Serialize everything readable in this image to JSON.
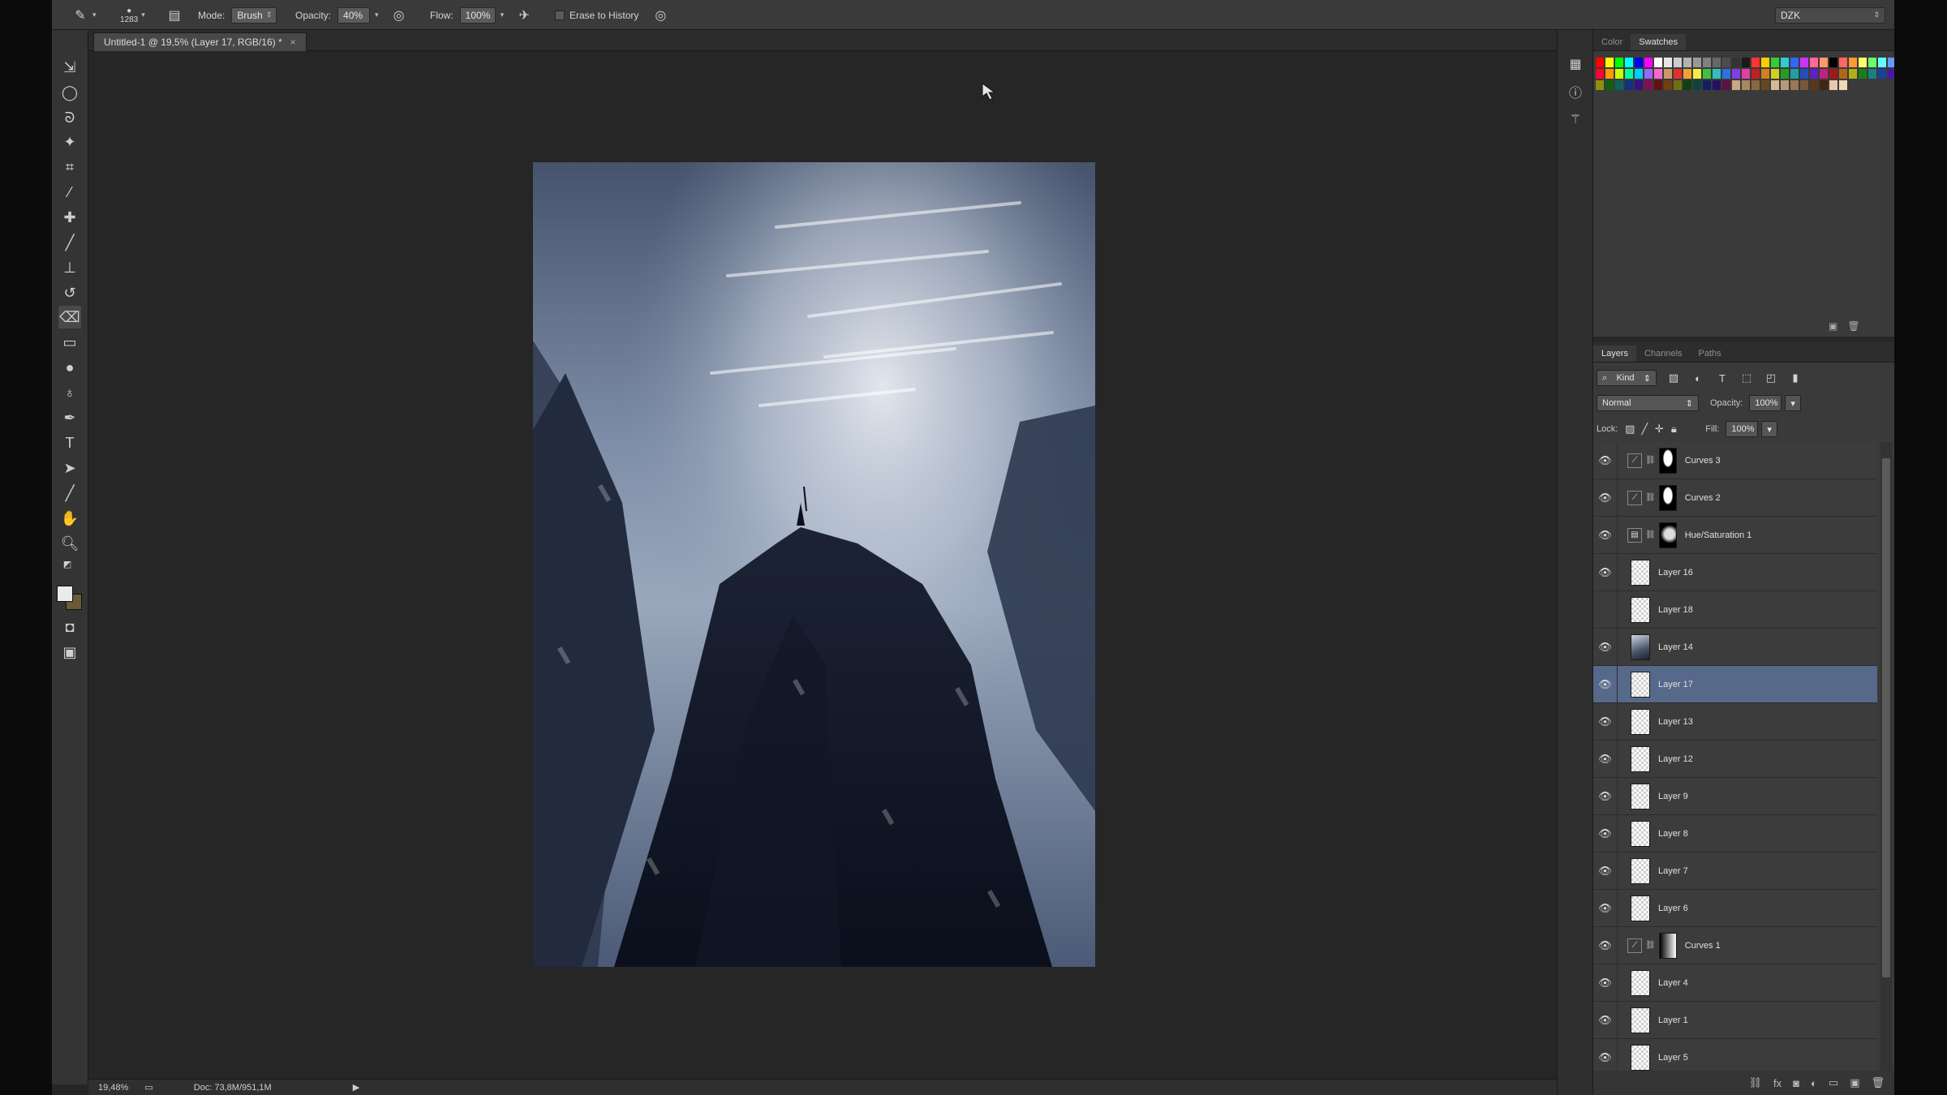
{
  "options_bar": {
    "brush_size": "1283",
    "mode_label": "Mode:",
    "mode_value": "Brush",
    "opacity_label": "Opacity:",
    "opacity_value": "40%",
    "flow_label": "Flow:",
    "flow_value": "100%",
    "erase_to_history": "Erase to History",
    "workspace": "DZK"
  },
  "document": {
    "tab_title": "Untitled-1 @ 19,5% (Layer 17, RGB/16) *",
    "close": "×"
  },
  "status_bar": {
    "zoom": "19,48%",
    "doc_info": "Doc: 73,8M/951,1M"
  },
  "swatches_panel": {
    "tabs": [
      "Color",
      "Swatches"
    ],
    "active_tab": "Swatches",
    "colors": [
      "#ff0000",
      "#ffff00",
      "#00ff00",
      "#00ffff",
      "#0000ff",
      "#ff00ff",
      "#ffffff",
      "#e6e6e6",
      "#cccccc",
      "#b3b3b3",
      "#999999",
      "#808080",
      "#666666",
      "#4d4d4d",
      "#333333",
      "#1a1a1a",
      "#ff3333",
      "#ffcc00",
      "#33cc33",
      "#33cccc",
      "#3366ff",
      "#cc33ff",
      "#ff6699",
      "#ff9966",
      "#000000",
      "#ff6666",
      "#ff9933",
      "#ffff66",
      "#66ff66",
      "#66ffff",
      "#6699ff",
      "#cc66ff",
      "#ff99cc",
      "#ffcc99",
      "#ff0033",
      "#ff9900",
      "#ccff00",
      "#00ff99",
      "#00ccff",
      "#9966ff",
      "#ff66cc",
      "#cc9966",
      "#e03030",
      "#f0a030",
      "#f0f040",
      "#40c040",
      "#30c0c0",
      "#3070e0",
      "#8040e0",
      "#e040a0",
      "#c02020",
      "#d08020",
      "#d0d020",
      "#20a020",
      "#20a0a0",
      "#2050c0",
      "#6020c0",
      "#c02080",
      "#a01818",
      "#b06818",
      "#b0b018",
      "#188018",
      "#188080",
      "#1840a0",
      "#4818a0",
      "#a01868",
      "#801010",
      "#905010",
      "#909010",
      "#106010",
      "#106060",
      "#103080",
      "#381080",
      "#801050",
      "#601010",
      "#704010",
      "#707010",
      "#104010",
      "#104040",
      "#102060",
      "#281060",
      "#601040",
      "#c8a880",
      "#a88860",
      "#886840",
      "#684820",
      "#d8b898",
      "#b89878",
      "#987858",
      "#785838",
      "#583818",
      "#402810",
      "#e8c8a8",
      "#f0d8b8"
    ],
    "buttons": [
      "new-swatch",
      "delete-swatch"
    ]
  },
  "layers_panel": {
    "tabs": [
      "Layers",
      "Channels",
      "Paths"
    ],
    "active_tab": "Layers",
    "filter_kind": "Kind",
    "blend_mode": "Normal",
    "opacity_label": "Opacity:",
    "opacity_value": "100%",
    "lock_label": "Lock:",
    "fill_label": "Fill:",
    "fill_value": "100%",
    "layers": [
      {
        "name": "Curves 3",
        "type": "curves",
        "visible": true,
        "mask": "white-blob"
      },
      {
        "name": "Curves 2",
        "type": "curves",
        "visible": true,
        "mask": "white-blob"
      },
      {
        "name": "Hue/Saturation 1",
        "type": "huesat",
        "visible": true,
        "mask": "figure"
      },
      {
        "name": "Layer 16",
        "type": "pixel",
        "visible": true
      },
      {
        "name": "Layer 18",
        "type": "pixel",
        "visible": false
      },
      {
        "name": "Layer 14",
        "type": "photo",
        "visible": true
      },
      {
        "name": "Layer 17",
        "type": "pixel",
        "visible": true,
        "selected": true
      },
      {
        "name": "Layer 13",
        "type": "pixel",
        "visible": true
      },
      {
        "name": "Layer 12",
        "type": "pixel",
        "visible": true
      },
      {
        "name": "Layer 9",
        "type": "pixel",
        "visible": true
      },
      {
        "name": "Layer 8",
        "type": "pixel",
        "visible": true
      },
      {
        "name": "Layer 7",
        "type": "pixel",
        "visible": true
      },
      {
        "name": "Layer 6",
        "type": "pixel",
        "visible": true
      },
      {
        "name": "Curves 1",
        "type": "curves",
        "visible": true,
        "mask": "gradient"
      },
      {
        "name": "Layer 4",
        "type": "pixel",
        "visible": true
      },
      {
        "name": "Layer 1",
        "type": "pixel",
        "visible": true
      },
      {
        "name": "Layer 5",
        "type": "pixel",
        "visible": true
      }
    ],
    "footer_icons": [
      "link-icon",
      "fx-icon",
      "mask-icon",
      "adjustment-icon",
      "group-icon",
      "new-layer-icon",
      "trash-icon"
    ]
  },
  "colors": {
    "selected_layer": "#56698a",
    "foreground": "#ebebeb",
    "background": "#6b5a3a"
  }
}
